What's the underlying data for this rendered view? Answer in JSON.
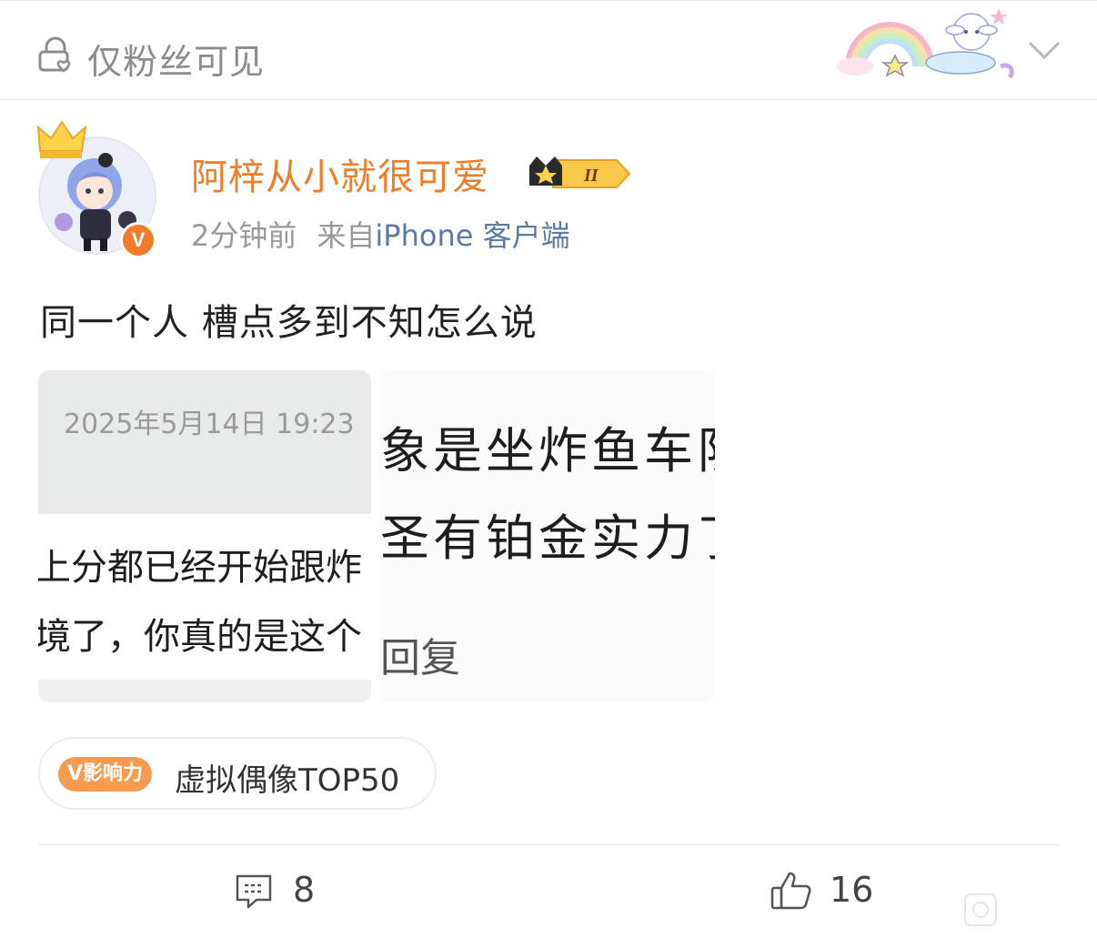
{
  "header": {
    "visibility_label": "仅粉丝可见",
    "lock_icon": "lock-icon",
    "chevron_icon": "chevron-down-icon"
  },
  "author": {
    "name": "阿梓从小就很可爱",
    "verified_mark": "V",
    "timestamp": "2分钟前",
    "source_prefix": "来自",
    "source_device": "iPhone 客户端",
    "level_badge_icon": "crown-level-icon"
  },
  "post": {
    "text": "同一个人 槽点多到不知怎么说",
    "images": [
      {
        "date": "2025年5月14日 19:23",
        "line1": "上分都已经开始跟炸",
        "line2": "境了，你真的是这个"
      },
      {
        "line1": "象是坐炸鱼车队",
        "line2": "圣有铂金实力了",
        "line3": "回复"
      }
    ]
  },
  "tag": {
    "badge": "V影响力",
    "label": "虚拟偶像TOP50"
  },
  "actions": {
    "comment_count": "8",
    "like_count": "16"
  },
  "colors": {
    "username": "#f07d2a",
    "meta_gray": "#999999",
    "device_blue": "#5a7aa8",
    "badge_orange": "#f59b52"
  }
}
